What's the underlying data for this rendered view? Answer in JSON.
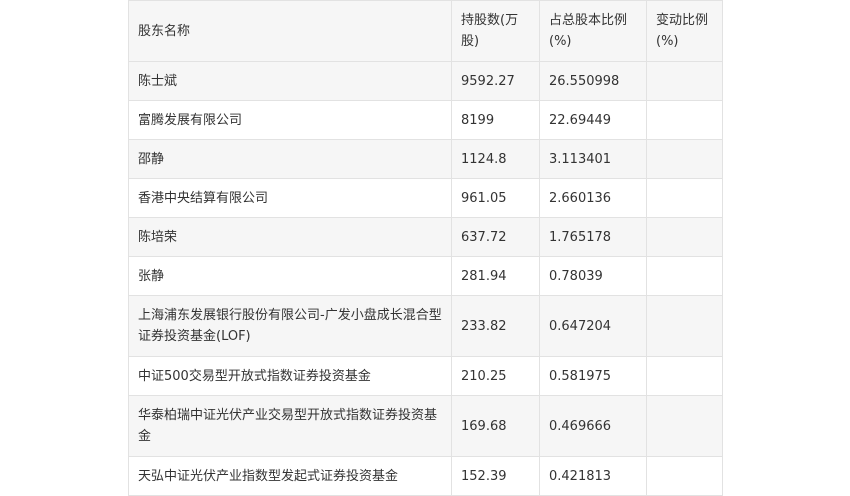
{
  "table": {
    "headers": [
      "股东名称",
      "持股数(万股)",
      "占总股本比例(%)",
      "变动比例(%)"
    ],
    "rows": [
      {
        "name": "陈士斌",
        "shares": "9592.27",
        "ratio": "26.550998",
        "change": ""
      },
      {
        "name": "富腾发展有限公司",
        "shares": "8199",
        "ratio": "22.69449",
        "change": ""
      },
      {
        "name": "邵静",
        "shares": "1124.8",
        "ratio": "3.113401",
        "change": ""
      },
      {
        "name": "香港中央结算有限公司",
        "shares": "961.05",
        "ratio": "2.660136",
        "change": ""
      },
      {
        "name": "陈培荣",
        "shares": "637.72",
        "ratio": "1.765178",
        "change": ""
      },
      {
        "name": "张静",
        "shares": "281.94",
        "ratio": "0.78039",
        "change": ""
      },
      {
        "name": "上海浦东发展银行股份有限公司-广发小盘成长混合型证券投资基金(LOF)",
        "shares": "233.82",
        "ratio": "0.647204",
        "change": ""
      },
      {
        "name": "中证500交易型开放式指数证券投资基金",
        "shares": "210.25",
        "ratio": "0.581975",
        "change": ""
      },
      {
        "name": "华泰柏瑞中证光伏产业交易型开放式指数证券投资基金",
        "shares": "169.68",
        "ratio": "0.469666",
        "change": ""
      },
      {
        "name": "天弘中证光伏产业指数型发起式证券投资基金",
        "shares": "152.39",
        "ratio": "0.421813",
        "change": ""
      }
    ]
  }
}
